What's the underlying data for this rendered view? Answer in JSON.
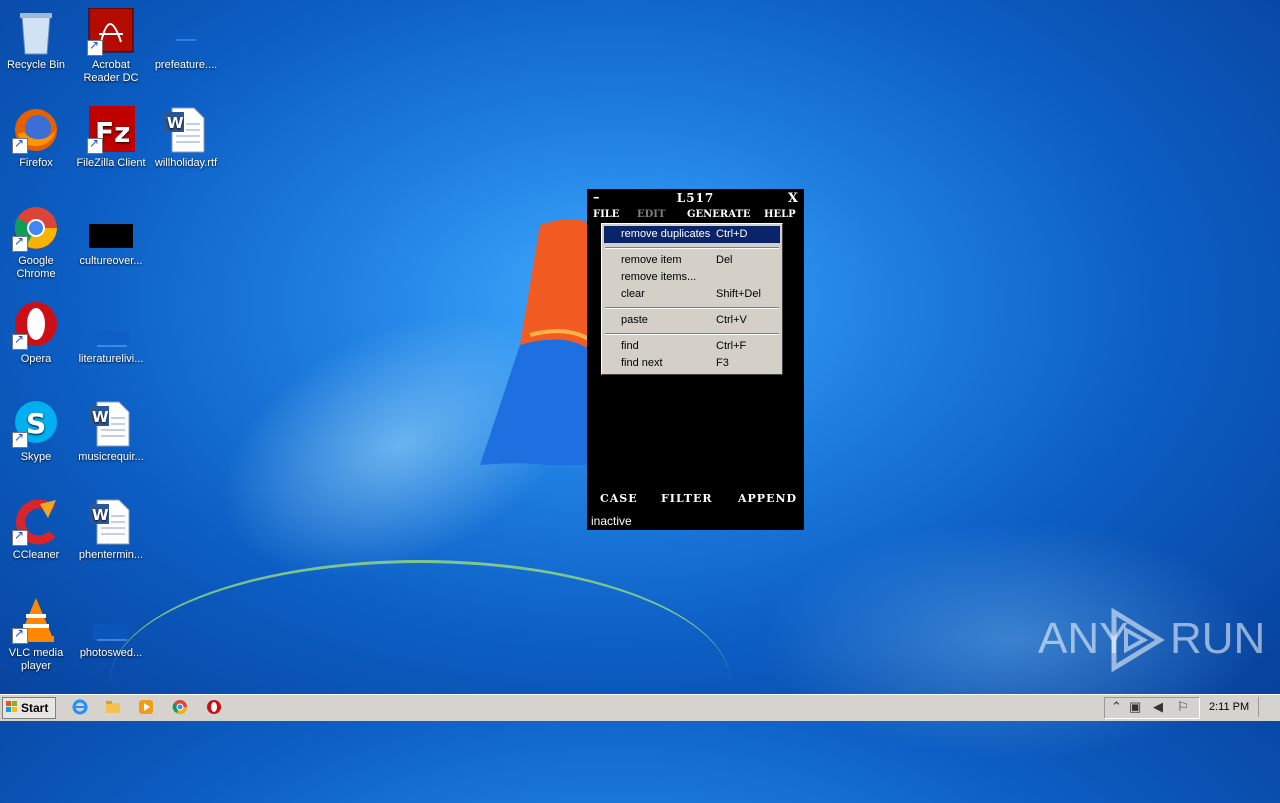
{
  "desktop": {
    "icons": [
      {
        "label": "Recycle Bin"
      },
      {
        "label": "Acrobat Reader DC"
      },
      {
        "label": "prefeature...."
      },
      {
        "label": "Firefox"
      },
      {
        "label": "FileZilla Client"
      },
      {
        "label": "willholiday.rtf"
      },
      {
        "label": "Google Chrome"
      },
      {
        "label": "cultureover..."
      },
      {
        "label": "Opera"
      },
      {
        "label": "literaturelivi..."
      },
      {
        "label": "Skype"
      },
      {
        "label": "musicrequir..."
      },
      {
        "label": "CCleaner"
      },
      {
        "label": "phentermin..."
      },
      {
        "label": "VLC media player"
      },
      {
        "label": "photoswed..."
      }
    ]
  },
  "window": {
    "minimize": "–",
    "title": "L517",
    "close": "X",
    "menu": {
      "file": "FILE",
      "edit": "EDIT",
      "generate": "GENERATE",
      "help": "HELP"
    },
    "bottom": {
      "case": "CASE",
      "filter": "FILTER",
      "append": "APPEND"
    },
    "status": "inactive"
  },
  "edit_menu": {
    "items": [
      {
        "label": "remove duplicates",
        "shortcut": "Ctrl+D"
      },
      {
        "label": "remove item",
        "shortcut": "Del"
      },
      {
        "label": "remove items...",
        "shortcut": ""
      },
      {
        "label": "clear",
        "shortcut": "Shift+Del"
      },
      {
        "label": "paste",
        "shortcut": "Ctrl+V"
      },
      {
        "label": "find",
        "shortcut": "Ctrl+F"
      },
      {
        "label": "find next",
        "shortcut": "F3"
      }
    ]
  },
  "watermark": {
    "left": "ANY",
    "right": "RUN"
  },
  "taskbar": {
    "start_label": "Start",
    "clock": "2:11 PM"
  },
  "colors": {
    "menu_highlight": "#0a246a",
    "menu_bg": "#d4d0c8",
    "window_bg": "#000000",
    "disabled_menu": "#808080"
  }
}
